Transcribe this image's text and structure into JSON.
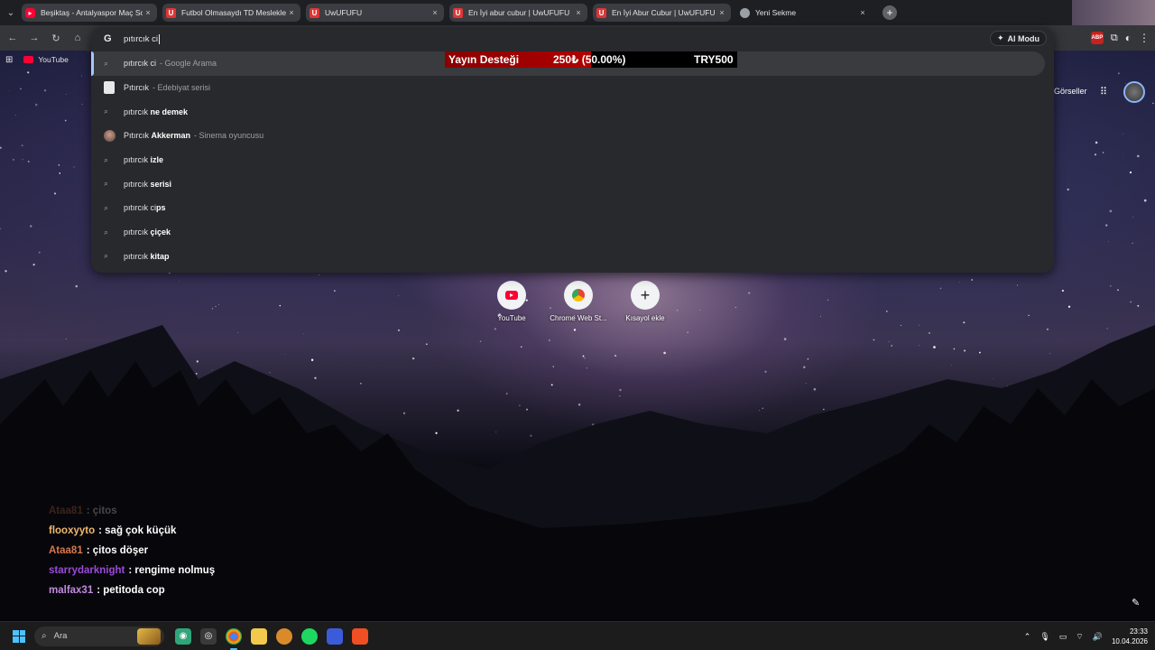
{
  "tabs": [
    {
      "label": "Beşiktaş - Antalyaspor Maç Sor",
      "favicon": "youtube-icon",
      "close": "×"
    },
    {
      "label": "Futbol Olmasaydı TD Meslekler",
      "favicon": "uwufufu-icon",
      "close": "×"
    },
    {
      "label": "UwUFUFU",
      "favicon": "uwufufu-icon",
      "close": "×"
    },
    {
      "label": "En İyi abur cubur | UwUFUFU",
      "favicon": "uwufufu-icon",
      "close": "×"
    },
    {
      "label": "En İyi Abur Cubur | UwUFUFU",
      "favicon": "uwufufu-icon",
      "close": "×"
    },
    {
      "label": "Yeni Sekme",
      "favicon": "chrome-icon",
      "close": "×"
    }
  ],
  "omnibox": {
    "text": "pıtırcık ci",
    "ai_mode": "AI Modu"
  },
  "suggestions": [
    {
      "main": "pıtırcık ci",
      "bold": "",
      "desc": "- Google Arama",
      "icon": "search-icon"
    },
    {
      "main": "Pıtırcık",
      "bold": "",
      "desc": "- Edebiyat serisi",
      "icon": "book-thumbnail"
    },
    {
      "main": "pıtırcık ",
      "bold": "ne demek",
      "desc": "",
      "icon": "search-icon"
    },
    {
      "main": "Pıtırcık ",
      "bold": "Akkerman",
      "desc": "- Sinema oyuncusu",
      "icon": "person-thumbnail"
    },
    {
      "main": "pıtırcık ",
      "bold": "izle",
      "desc": "",
      "icon": "search-icon"
    },
    {
      "main": "pıtırcık ",
      "bold": "serisi",
      "desc": "",
      "icon": "search-icon"
    },
    {
      "main": "pıtırcık ci",
      "bold": "ps",
      "desc": "",
      "icon": "search-icon"
    },
    {
      "main": "pıtırcık ",
      "bold": "çiçek",
      "desc": "",
      "icon": "search-icon"
    },
    {
      "main": "pıtırcık ",
      "bold": "kitap",
      "desc": "",
      "icon": "search-icon"
    }
  ],
  "bookmarks": {
    "youtube": "YouTube"
  },
  "donation": {
    "title": "Yayın Desteği",
    "amount": "250₺ (50.00%)",
    "target": "TRY500",
    "progress": 0.5
  },
  "ntp": {
    "images_link": "Görseller",
    "shortcuts": [
      {
        "label": "YouTube",
        "icon": "youtube-icon"
      },
      {
        "label": "Chrome Web St...",
        "icon": "chrome-web-store-icon"
      },
      {
        "label": "Kısayol ekle",
        "icon": "plus-icon"
      }
    ]
  },
  "chat": [
    {
      "user": "Ataa81",
      "msg": ": çitos",
      "color": "#d7774a",
      "faded": true
    },
    {
      "user": "flooxyyto",
      "msg": ": sağ çok küçük",
      "color": "#f0b86e",
      "faded": false
    },
    {
      "user": "Ataa81",
      "msg": ": çitos döşer",
      "color": "#d7774a",
      "faded": false
    },
    {
      "user": "starrydarknight",
      "msg": ": rengime nolmuş",
      "color": "#9b4ad6",
      "faded": false
    },
    {
      "user": "malfax31",
      "msg": ": petitoda cop",
      "color": "#c28be0",
      "faded": false
    }
  ],
  "taskbar": {
    "search_placeholder": "Ara",
    "time": "23:33",
    "date": "10.04.2026"
  }
}
